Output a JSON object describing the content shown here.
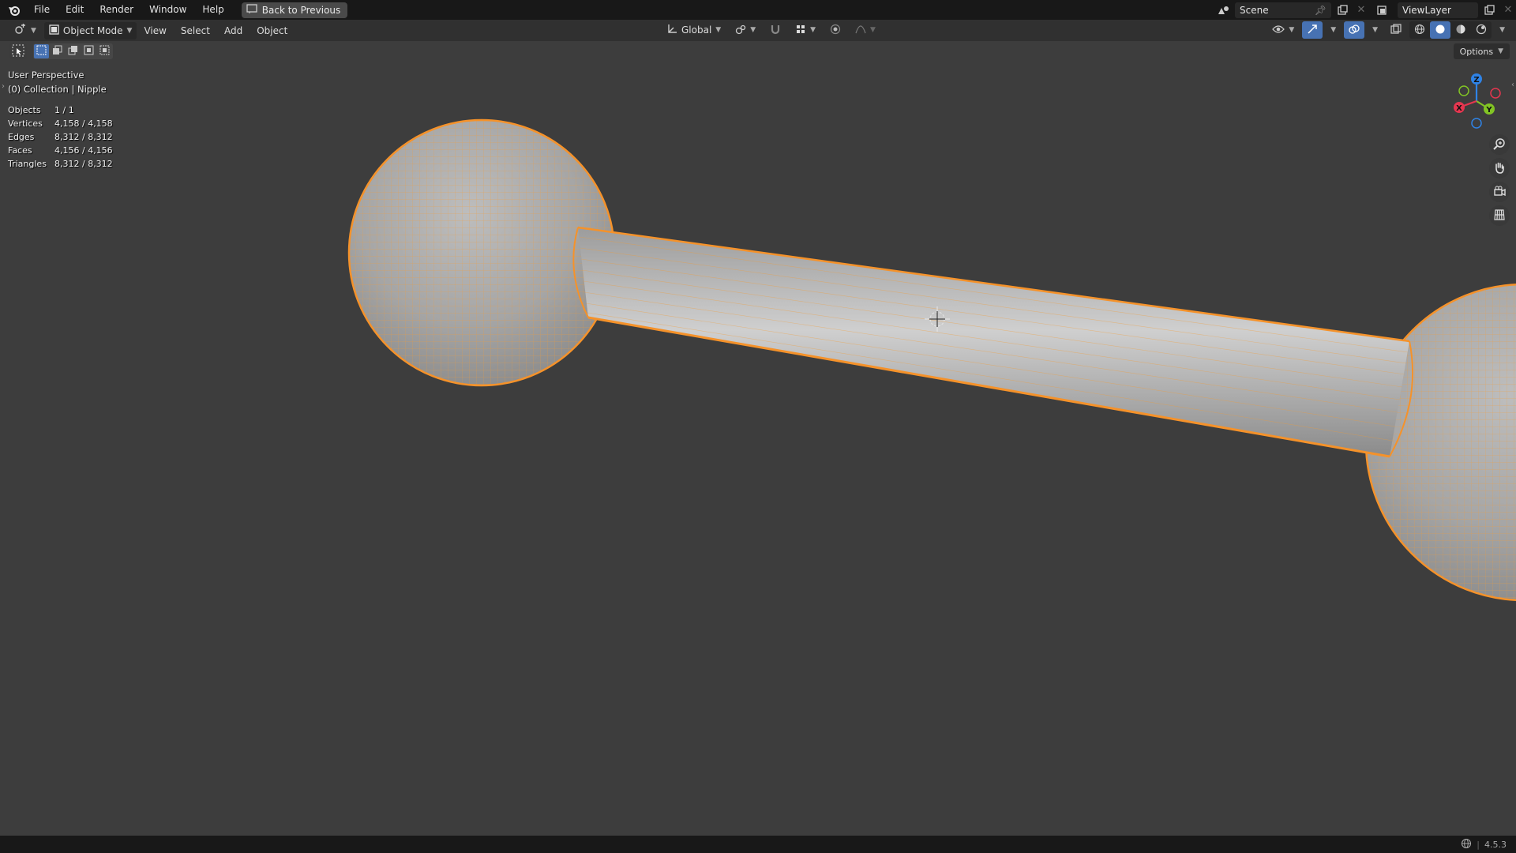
{
  "menu": {
    "items": [
      "File",
      "Edit",
      "Render",
      "Window",
      "Help"
    ],
    "back_label": "Back to Previous"
  },
  "top_right": {
    "scene": "Scene",
    "view_layer": "ViewLayer"
  },
  "header": {
    "mode": "Object Mode",
    "menus": [
      "View",
      "Select",
      "Add",
      "Object"
    ],
    "transform_orientation": "Global"
  },
  "options_label": "Options",
  "overlay": {
    "perspective": "User Perspective",
    "collection": "(0) Collection | Nipple"
  },
  "stats": [
    {
      "label": "Objects",
      "value": "1 / 1"
    },
    {
      "label": "Vertices",
      "value": "4,158 / 4,158"
    },
    {
      "label": "Edges",
      "value": "8,312 / 8,312"
    },
    {
      "label": "Faces",
      "value": "4,156 / 4,156"
    },
    {
      "label": "Triangles",
      "value": "8,312 / 8,312"
    }
  ],
  "gizmo": {
    "x": "X",
    "y": "Y",
    "z": "Z"
  },
  "version": "4.5.3",
  "colors": {
    "selection_outline": "#f5922a",
    "active_blue": "#4772b3",
    "axis_x": "#e5364f",
    "axis_y": "#82c424",
    "axis_z": "#2f83e6"
  }
}
